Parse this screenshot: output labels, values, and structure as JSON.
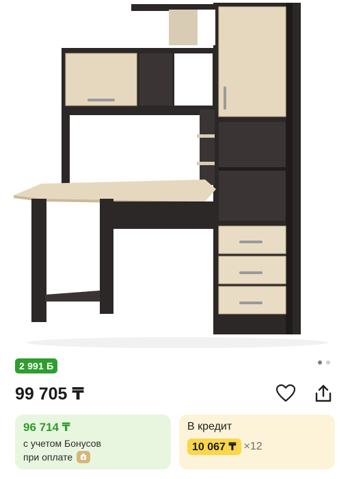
{
  "product": {
    "image_name": "desk-photo",
    "bonus_badge": "2 991 Б",
    "price": "99 705 ₸",
    "gallery": {
      "pages": 2,
      "active": 0
    }
  },
  "bonus_card": {
    "price": "96 714 ₸",
    "note_line1": "с учетом Бонусов",
    "note_line2": "при оплате"
  },
  "credit_card": {
    "title": "В кредит",
    "monthly": "10 067 ₸",
    "months": "×12"
  },
  "icons": {
    "favorite": "heart-icon",
    "share": "share-icon",
    "pay": "wallet-badge-icon"
  },
  "colors": {
    "bonus_green": "#2f9e2f",
    "bonus_card_bg": "#e9f6df",
    "credit_card_bg": "#fcf3d8",
    "credit_amount_bg": "#fad64a",
    "wenge": "#2b2827",
    "oak_light": "#e9dcc5"
  }
}
